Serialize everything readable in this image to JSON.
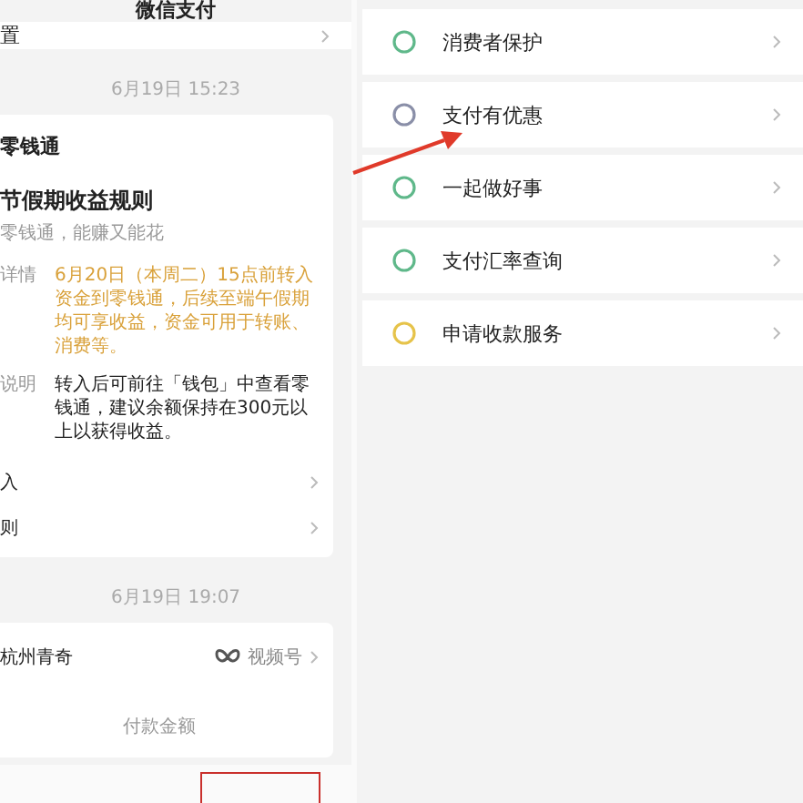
{
  "header": {
    "title": "微信支付"
  },
  "settings_row": {
    "label": "置"
  },
  "messages": [
    {
      "time": "6月19日 15:23",
      "kind": "notice",
      "app": "零钱通",
      "title": "节假期收益规则",
      "subtitle": "零钱通，能赚又能花",
      "fields": [
        {
          "label": "详情",
          "value": "6月20日（本周二）15点前转入资金到零钱通，后续至端午假期均可享收益，资金可用于转账、消费等。",
          "kind": "highlight"
        },
        {
          "label": "说明",
          "value": "转入后可前往「钱包」中查看零钱通，建议余额保持在300元以上以获得收益。",
          "kind": "plain"
        }
      ],
      "links": [
        "入",
        "则"
      ]
    },
    {
      "time": "6月19日 19:07",
      "kind": "payment",
      "merchant": "杭州青奇",
      "source": "视频号",
      "amount_label": "付款金额"
    }
  ],
  "services": [
    {
      "label": "消费者保护",
      "color": "#5fb88a"
    },
    {
      "label": "支付有优惠",
      "color": "#8a8fa8"
    },
    {
      "label": "一起做好事",
      "color": "#5fb88a"
    },
    {
      "label": "支付汇率查询",
      "color": "#5fb88a"
    },
    {
      "label": "申请收款服务",
      "color": "#e6c34a"
    }
  ]
}
